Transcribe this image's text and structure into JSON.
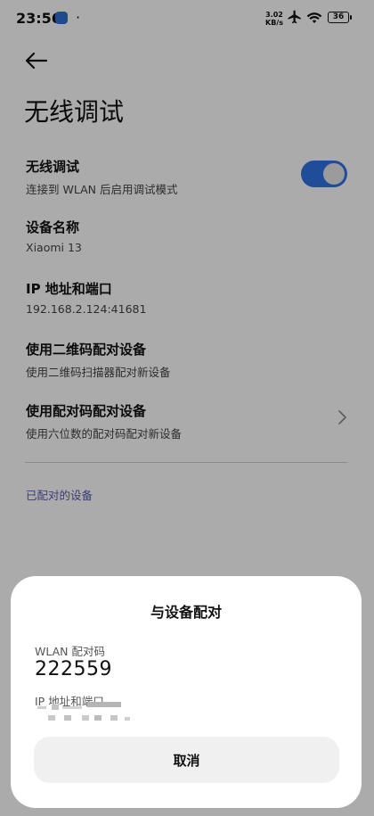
{
  "status_bar": {
    "time": "23:56",
    "dot": "·",
    "speed_value": "3.02",
    "speed_unit": "KB/s",
    "battery": "36",
    "icons": [
      "app-notification-icon",
      "airplane-icon",
      "wifi-icon",
      "battery-icon"
    ]
  },
  "header": {
    "title": "无线调试"
  },
  "settings": {
    "wireless_debugging": {
      "title": "无线调试",
      "subtitle": "连接到 WLAN 后启用调试模式",
      "enabled": true
    },
    "device_name": {
      "title": "设备名称",
      "value": "Xiaomi 13"
    },
    "ip_port": {
      "title": "IP 地址和端口",
      "value": "192.168.2.124:41681"
    },
    "qr_pair": {
      "title": "使用二维码配对设备",
      "subtitle": "使用二维码扫描器配对新设备"
    },
    "code_pair": {
      "title": "使用配对码配对设备",
      "subtitle": "使用六位数的配对码配对新设备"
    },
    "paired_devices_label": "已配对的设备"
  },
  "dialog": {
    "title": "与设备配对",
    "code_label": "WLAN 配对码",
    "code_value": "222559",
    "ip_label": "IP 地址和端口",
    "cancel_label": "取消"
  },
  "colors": {
    "accent": "#2f74e6",
    "section_label": "#5a5ab0",
    "scrim": "rgba(0,0,0,0.33)"
  }
}
